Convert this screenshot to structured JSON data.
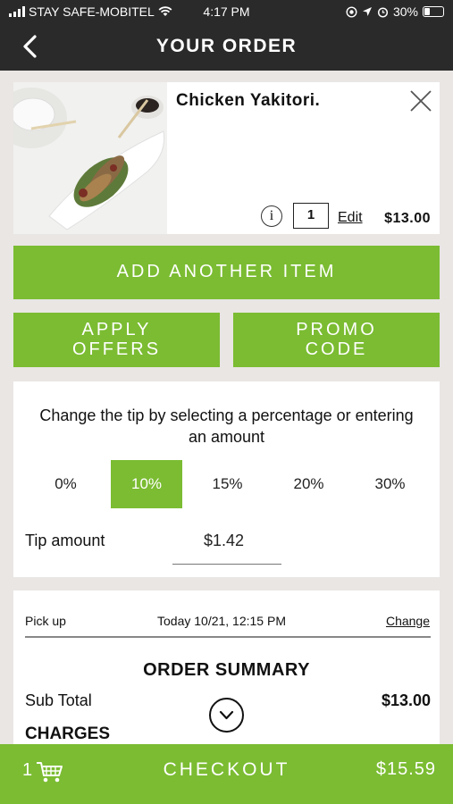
{
  "status_bar": {
    "carrier": "STAY SAFE-MOBITEL",
    "time": "4:17 PM",
    "battery": "30%",
    "battery_level": 0.3
  },
  "header": {
    "title": "YOUR ORDER",
    "back_icon": "chevron-left-icon"
  },
  "item": {
    "name": "Chicken Yakitori.",
    "quantity": "1",
    "edit_label": "Edit",
    "price": "$13.00",
    "info_glyph": "i",
    "close_icon": "close-icon"
  },
  "actions": {
    "add_another": "ADD ANOTHER ITEM",
    "apply_offers_line1": "APPLY",
    "apply_offers_line2": "OFFERS",
    "promo_code_line1": "PROMO",
    "promo_code_line2": "CODE"
  },
  "tip": {
    "instruction": "Change the tip by selecting a percentage or entering an amount",
    "options": [
      "0%",
      "10%",
      "15%",
      "20%",
      "30%"
    ],
    "selected": "10%",
    "amount_label": "Tip amount",
    "amount_value": "$1.42"
  },
  "summary": {
    "pickup_label": "Pick up",
    "pickup_time": "Today 10/21, 12:15 PM",
    "change_label": "Change",
    "title": "ORDER SUMMARY",
    "subtotal_label": "Sub Total",
    "subtotal_value": "$13.00",
    "charges_label": "CHARGES"
  },
  "checkout": {
    "cart_count": "1",
    "label": "CHECKOUT",
    "total": "$15.59"
  },
  "colors": {
    "accent": "#7bbc32",
    "header_bg": "#2a2a2a",
    "page_bg": "#e9e6e4"
  }
}
